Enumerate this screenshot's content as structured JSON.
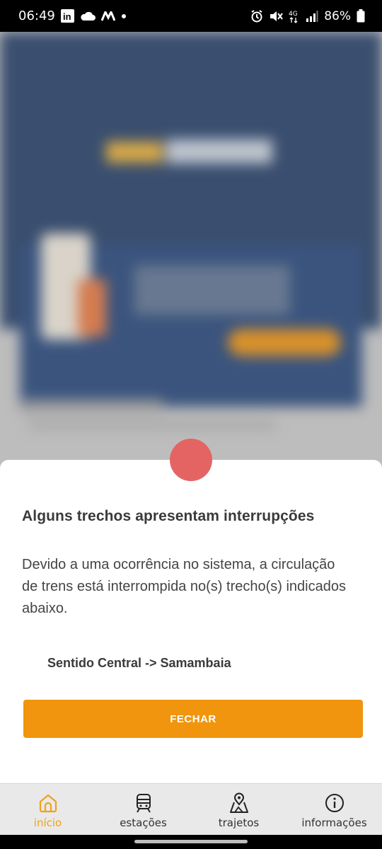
{
  "status_bar": {
    "time": "06:49",
    "battery": "86%",
    "network": "4G",
    "icons": [
      "linkedin-icon",
      "cloud-icon",
      "m-icon",
      "dot-icon",
      "alarm-icon",
      "mute-icon",
      "4g-icon",
      "signal-icon",
      "battery-icon"
    ]
  },
  "modal": {
    "title": "Alguns trechos apresentam interrupções",
    "message": "Devido a uma ocorrência no sistema, a circulação de trens está interrompida no(s) trecho(s) indicados abaixo.",
    "route": "Sentido Central -> Samambaia",
    "close_label": "FECHAR",
    "status_color": "#e46464",
    "button_color": "#f0950d"
  },
  "nav": {
    "items": [
      {
        "label": "início",
        "icon": "home-icon",
        "active": true
      },
      {
        "label": "estações",
        "icon": "train-icon",
        "active": false
      },
      {
        "label": "trajetos",
        "icon": "map-pin-icon",
        "active": false
      },
      {
        "label": "informações",
        "icon": "info-icon",
        "active": false
      }
    ],
    "active_color": "#f0a21a"
  }
}
